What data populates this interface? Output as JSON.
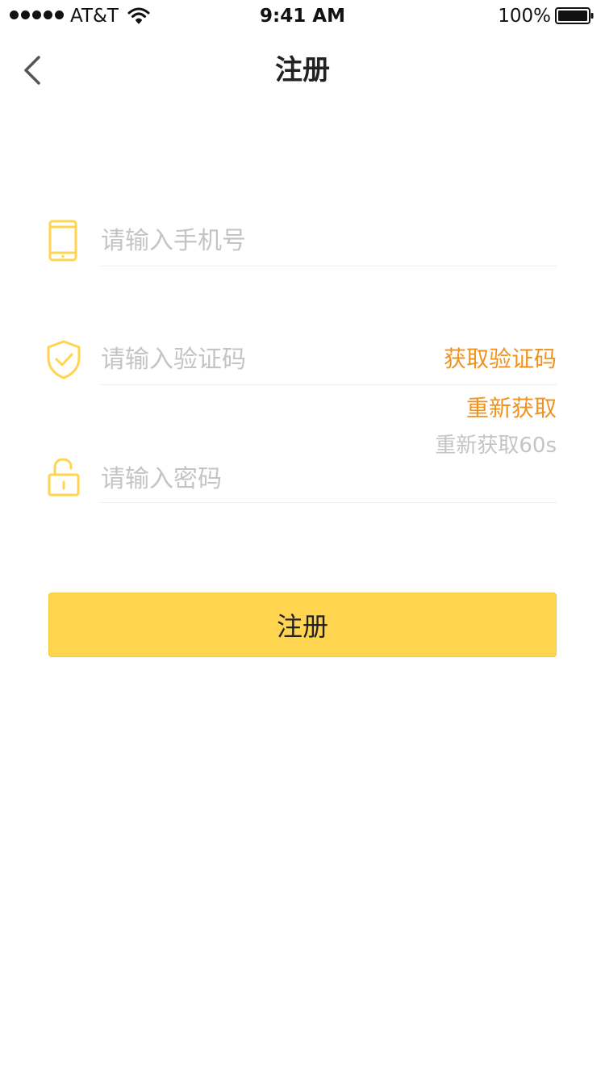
{
  "status_bar": {
    "carrier": "AT&T",
    "time": "9:41 AM",
    "battery": "100%",
    "icons": [
      "signal-dots-icon",
      "wifi-icon",
      "battery-icon"
    ]
  },
  "nav": {
    "back_icon": "chevron-left-icon",
    "title": "注册"
  },
  "form": {
    "phone": {
      "icon": "phone-icon",
      "placeholder": "请输入手机号",
      "value": ""
    },
    "code": {
      "icon": "shield-check-icon",
      "placeholder": "请输入验证码",
      "value": "",
      "get_code_label": "获取验证码",
      "resend_label": "重新获取",
      "countdown_label": "重新获取60s"
    },
    "password": {
      "icon": "unlock-icon",
      "placeholder": "请输入密码",
      "value": ""
    },
    "submit_label": "注册"
  },
  "colors": {
    "accent_yellow": "#ffd54f",
    "icon_yellow": "#ffd54f",
    "link_orange": "#f0921e",
    "placeholder_grey": "#c4c4c4",
    "divider": "#ececec"
  }
}
